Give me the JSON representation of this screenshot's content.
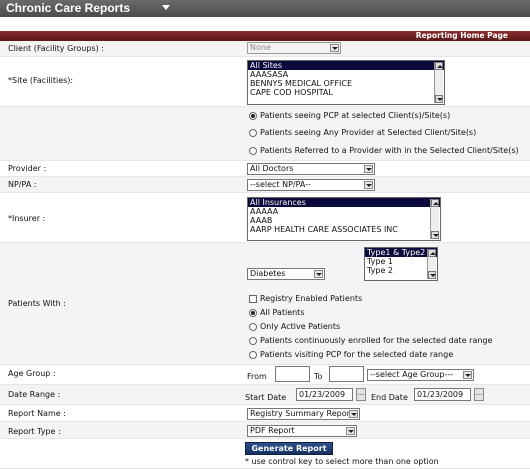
{
  "app": {
    "title": "Chronic Care Reports"
  },
  "header": {
    "band_text": "Reporting Home Page"
  },
  "client": {
    "label": "Client (Facility Groups) :",
    "value": "None"
  },
  "site": {
    "label": "*Site (Facilities):",
    "options": [
      "All Sites",
      "AAASASA",
      "BENNYS MEDICAL OFFICE",
      "CAPE COD HOSPITAL"
    ]
  },
  "pcp_options": [
    "Patients seeing PCP at selected Client(s)/Site(s)",
    "Patients seeing Any Provider at Selected Client/Site(s)",
    "Patients Referred to a Provider with in the Selected Client/Site(s)"
  ],
  "provider": {
    "label": "Provider :",
    "value": "All Doctors"
  },
  "nppa": {
    "label": "NP/PA :",
    "value": "--select NP/PA--"
  },
  "insurer": {
    "label": "*Insurer :",
    "options": [
      "All Insurances",
      "AAAAA",
      "AAAB",
      "AARP HEALTH CARE ASSOCIATES INC"
    ]
  },
  "patients_with": {
    "label": "Patients With :",
    "condition": "Diabetes",
    "types": [
      "Type1 & Type2",
      "Type 1",
      "Type 2"
    ],
    "registry_label": "Registry Enabled Patients",
    "radios": [
      "All Patients",
      "Only Active Patients",
      "Patients continuously enrolled for the selected date range",
      "Patients visiting PCP for the selected date range"
    ]
  },
  "age_group": {
    "label": "Age Group :",
    "from_label": "From",
    "to_label": "To",
    "select_value": "--select Age Group---"
  },
  "date_range": {
    "label": "Date Range :",
    "start_label": "Start Date",
    "start_value": "01/23/2009",
    "end_label": "End Date",
    "end_value": "01/23/2009",
    "picker_glyph": "..."
  },
  "report_name": {
    "label": "Report Name :",
    "value": "Registry Summary Report"
  },
  "report_type": {
    "label": "Report Type :",
    "value": "PDF Report"
  },
  "generate_button": "Generate Report",
  "footnote": "* use control key to select more than one option"
}
